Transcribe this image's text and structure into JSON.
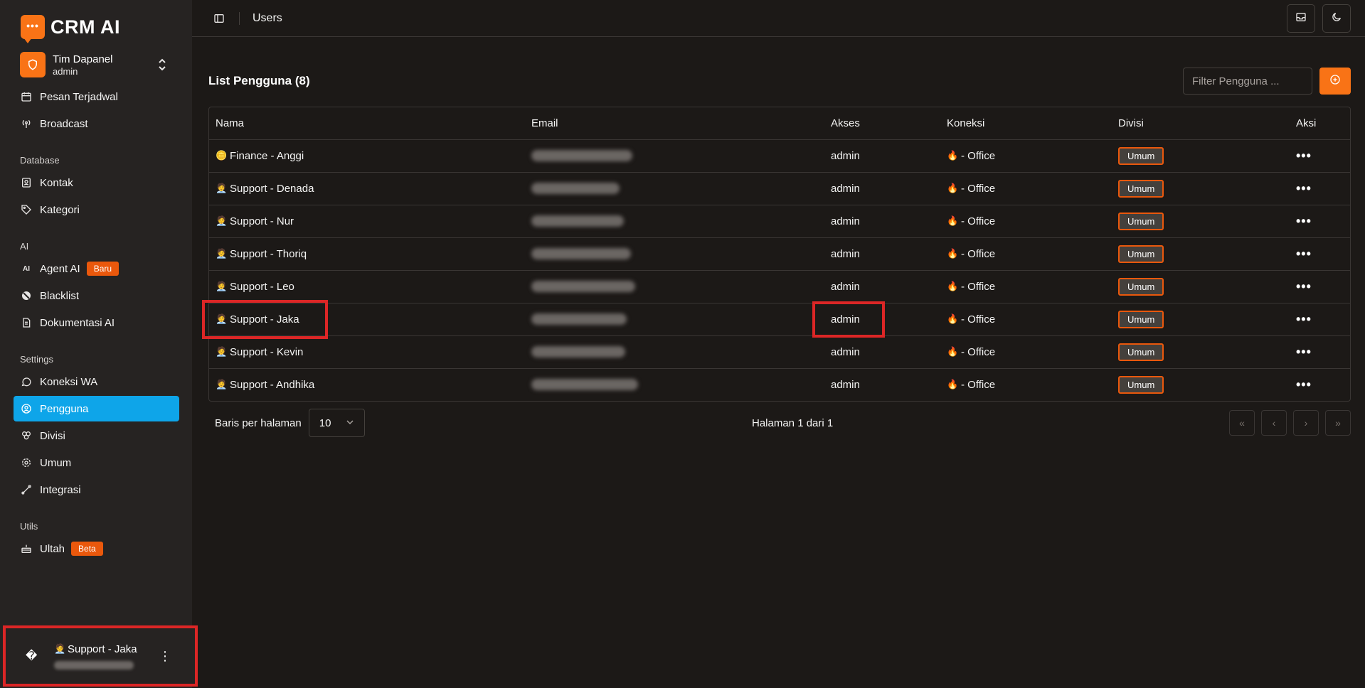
{
  "brand": {
    "logo_text": "•••",
    "name": "CRM AI",
    "accent": "#f97316"
  },
  "team": {
    "name": "Tim Dapanel",
    "role": "admin"
  },
  "nav": {
    "top": [
      {
        "label": "Pesan Terjadwal",
        "icon": "calendar-clock-icon"
      },
      {
        "label": "Broadcast",
        "icon": "broadcast-icon"
      }
    ],
    "database_label": "Database",
    "database": [
      {
        "label": "Kontak",
        "icon": "contact-icon"
      },
      {
        "label": "Kategori",
        "icon": "tag-icon"
      }
    ],
    "ai_label": "AI",
    "ai": [
      {
        "label": "Agent AI",
        "icon": "ai-icon",
        "badge": "Baru"
      },
      {
        "label": "Blacklist",
        "icon": "block-icon"
      },
      {
        "label": "Dokumentasi AI",
        "icon": "document-icon"
      }
    ],
    "settings_label": "Settings",
    "settings": [
      {
        "label": "Koneksi WA",
        "icon": "whatsapp-icon"
      },
      {
        "label": "Pengguna",
        "icon": "user-circle-icon",
        "active": true
      },
      {
        "label": "Divisi",
        "icon": "division-icon"
      },
      {
        "label": "Umum",
        "icon": "gear-icon"
      },
      {
        "label": "Integrasi",
        "icon": "integration-icon"
      }
    ],
    "utils_label": "Utils",
    "utils": [
      {
        "label": "Ultah",
        "icon": "cake-icon",
        "badge": "Beta"
      }
    ]
  },
  "current_user": {
    "emoji": "🧑‍💼",
    "name": "Support - Jaka",
    "icon_glyph": "�"
  },
  "topbar": {
    "title": "Users"
  },
  "list": {
    "title": "List Pengguna (8)",
    "filter_placeholder": "Filter Pengguna ...",
    "columns": [
      "Nama",
      "Email",
      "Akses",
      "Koneksi",
      "Divisi",
      "Aksi"
    ],
    "rows": [
      {
        "emoji": "🪙",
        "name": "Finance - Anggi",
        "akses": "admin",
        "koneksi_emoji": "🔥",
        "koneksi": "- Office",
        "divisi": "Umum"
      },
      {
        "emoji": "🧑‍💼",
        "name": "Support - Denada",
        "akses": "admin",
        "koneksi_emoji": "🔥",
        "koneksi": "- Office",
        "divisi": "Umum"
      },
      {
        "emoji": "🧑‍💼",
        "name": "Support - Nur",
        "akses": "admin",
        "koneksi_emoji": "🔥",
        "koneksi": "- Office",
        "divisi": "Umum"
      },
      {
        "emoji": "🧑‍💼",
        "name": "Support - Thoriq",
        "akses": "admin",
        "koneksi_emoji": "🔥",
        "koneksi": "- Office",
        "divisi": "Umum"
      },
      {
        "emoji": "🧑‍💼",
        "name": "Support - Leo",
        "akses": "admin",
        "koneksi_emoji": "🔥",
        "koneksi": "- Office",
        "divisi": "Umum"
      },
      {
        "emoji": "🧑‍💼",
        "name": "Support - Jaka",
        "akses": "admin",
        "koneksi_emoji": "🔥",
        "koneksi": "- Office",
        "divisi": "Umum"
      },
      {
        "emoji": "🧑‍💼",
        "name": "Support - Kevin",
        "akses": "admin",
        "koneksi_emoji": "🔥",
        "koneksi": "- Office",
        "divisi": "Umum"
      },
      {
        "emoji": "🧑‍💼",
        "name": "Support - Andhika",
        "akses": "admin",
        "koneksi_emoji": "🔥",
        "koneksi": "- Office",
        "divisi": "Umum"
      }
    ],
    "action_glyph": "•••"
  },
  "pagination": {
    "rows_per_page_label": "Baris per halaman",
    "rows_per_page_value": "10",
    "page_info": "Halaman 1 dari 1",
    "first": "«",
    "prev": "‹",
    "next": "›",
    "last": "»"
  },
  "colors": {
    "sidebar_bg": "#262322",
    "main_bg": "#1c1917",
    "active": "#0ea5e9",
    "highlight": "#dc2626",
    "badge": "#ea580c"
  }
}
